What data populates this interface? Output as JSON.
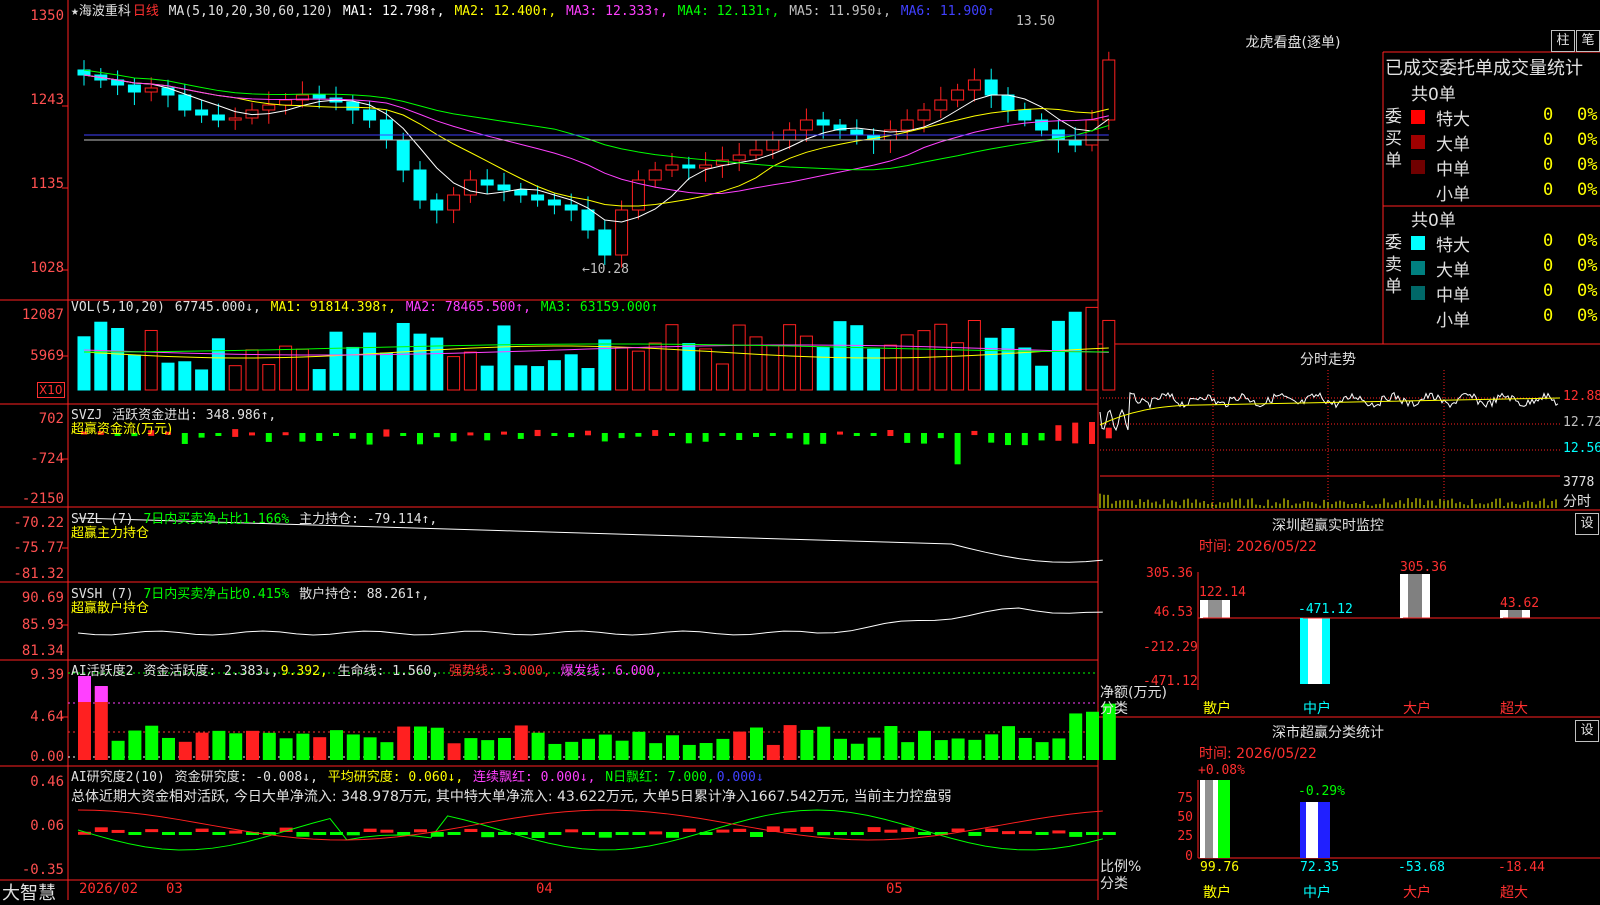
{
  "main": {
    "header": {
      "stock": "★海波重科",
      "period": "日线",
      "ma": "MA(5,10,20,30,60,120)",
      "ma1": "MA1: 12.798↑,",
      "ma2": "MA2: 12.400↑,",
      "ma3": "MA3: 12.333↑,",
      "ma4": "MA4: 12.131↑,",
      "ma5": "MA5: 11.950↓,",
      "ma6": "MA6: 11.900↑"
    },
    "yticks": [
      "1350",
      "1243",
      "1135",
      "1028"
    ],
    "high_label": "13.50",
    "low_label": "←10.28"
  },
  "vol": {
    "yticks": [
      "12087",
      "5969"
    ],
    "unit": "X10",
    "h1": "VOL(5,10,20)",
    "h2": "67745.000↓,",
    "h3": "MA1: 91814.398↑,",
    "h4": "MA2: 78465.500↑,",
    "h5": "MA3: 63159.000↑"
  },
  "svzj": {
    "yticks": [
      "702",
      "-724",
      "-2150"
    ],
    "h1": "SVZJ",
    "h2": "活跃资金进出: 348.986↑,",
    "h3": "超赢资金流(万元)"
  },
  "svzl": {
    "yticks": [
      "-70.22",
      "-75.77",
      "-81.32"
    ],
    "h1": "SVZL (7)",
    "h2": "7日内买卖净占比1.166%",
    "h3": "主力持仓: -79.114↑,",
    "h4": "超赢主力持仓"
  },
  "svsh": {
    "yticks": [
      "90.69",
      "85.93",
      "81.34"
    ],
    "h1": "SVSH (7)",
    "h2": "7日内买卖净占比0.415%",
    "h3": "散户持仓: 88.261↑,",
    "h4": "超赢散户持仓"
  },
  "ai1": {
    "yticks": [
      "9.39",
      "4.64",
      "0.00"
    ],
    "h1": "AI活跃度2",
    "h2": "资金活跃度: 2.383↓,",
    "h3": "9.392,",
    "h4": "生命线: 1.560,",
    "h5": "强势线: 3.000,",
    "h6": "爆发线: 6.000,"
  },
  "ai2": {
    "yticks": [
      "0.46",
      "0.06",
      "-0.35"
    ],
    "h1": "AI研究度2(10)",
    "h2": "资金研究度: -0.008↓,",
    "h3": "平均研究度: 0.060↓,",
    "h4": "连续飘红: 0.000↓,",
    "h5": "N日飘红: 7.000,",
    "h6": "0.000↓",
    "summary": "总体近期大资金相对活跃, 今日大单净流入: 348.978万元, 其中特大单净流入: 43.622万元, 大单5日累计净入1667.542万元, 当前主力控盘弱"
  },
  "bottom": {
    "brand": "大智慧",
    "dates": [
      "2026/02",
      "03",
      "04",
      "05"
    ]
  },
  "longhu": {
    "title": "龙虎看盘(逐单)",
    "btn1": "柱",
    "btn2": "笔",
    "tabs": [
      "已成交",
      "委托单",
      "成交量统计"
    ],
    "buy": {
      "label": "委买单",
      "total": "共0单",
      "rows": [
        {
          "name": "特大",
          "count": "0",
          "pct": "0%",
          "color": "#ff0000"
        },
        {
          "name": "大单",
          "count": "0",
          "pct": "0%",
          "color": "#a00000"
        },
        {
          "name": "中单",
          "count": "0",
          "pct": "0%",
          "color": "#700000"
        },
        {
          "name": "小单",
          "count": "0",
          "pct": "0%",
          "color": ""
        }
      ]
    },
    "sell": {
      "label": "委卖单",
      "total": "共0单",
      "rows": [
        {
          "name": "特大",
          "count": "0",
          "pct": "0%",
          "color": "#00ffff"
        },
        {
          "name": "大单",
          "count": "0",
          "pct": "0%",
          "color": "#008080"
        },
        {
          "name": "中单",
          "count": "0",
          "pct": "0%",
          "color": "#006868"
        },
        {
          "name": "小单",
          "count": "0",
          "pct": "0%",
          "color": ""
        }
      ]
    }
  },
  "fenshi": {
    "title": "分时走势",
    "yticks": [
      "12.88",
      "12.72",
      "12.56",
      "3778",
      "分时"
    ]
  },
  "szjk": {
    "title": "深圳超赢实时监控",
    "btn": "设",
    "time": "时间: 2026/05/22",
    "yticks": [
      "305.36",
      "46.53",
      "-212.29",
      "-471.12"
    ],
    "ylabel": "净额(万元)",
    "xlabel": "分类",
    "cats": [
      "散户",
      "中户",
      "大户",
      "超大"
    ],
    "values": [
      "122.14",
      "-471.12",
      "305.36",
      "43.62"
    ]
  },
  "szfl": {
    "title": "深市超赢分类统计",
    "btn": "设",
    "time": "时间: 2026/05/22",
    "yticks": [
      "75",
      "50",
      "25",
      "0"
    ],
    "ylabel": "比例%",
    "xlabel": "分类",
    "cats": [
      "散户",
      "中户",
      "大户",
      "超大"
    ],
    "top": [
      "+0.08%",
      "-0.29%"
    ],
    "bottom": [
      "99.76",
      "72.35",
      "-53.68",
      "-18.44"
    ]
  }
}
